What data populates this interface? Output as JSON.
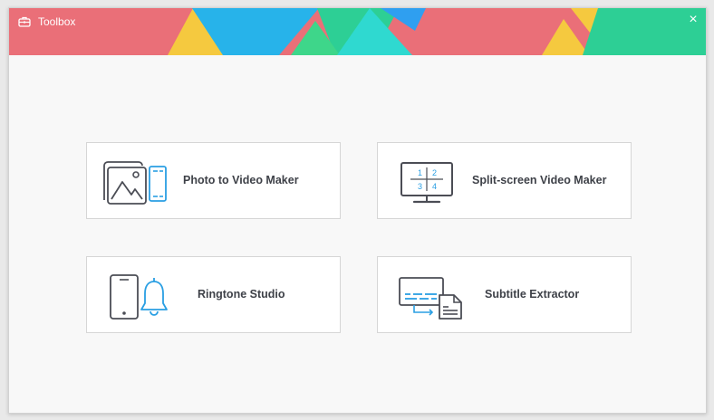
{
  "window": {
    "title": "Toolbox",
    "title_icon": "toolbox-icon",
    "close_icon": "close-icon",
    "close_glyph": "×"
  },
  "banner_colors": [
    "#ea6f78",
    "#f5c93f",
    "#27b3ea",
    "#3ed68a",
    "#2fd9d0",
    "#2f9ff0",
    "#2dcf95"
  ],
  "tools": [
    {
      "id": "photo-to-video-maker",
      "label": "Photo to Video Maker",
      "icon": "photo-film-icon"
    },
    {
      "id": "split-screen-video-maker",
      "label": "Split-screen Video Maker",
      "icon": "split-screen-monitor-icon",
      "icon_numbers": [
        "1",
        "2",
        "3",
        "4"
      ]
    },
    {
      "id": "ringtone-studio",
      "label": "Ringtone Studio",
      "icon": "phone-bell-icon"
    },
    {
      "id": "subtitle-extractor",
      "label": "Subtitle Extractor",
      "icon": "subtitle-document-icon"
    }
  ],
  "colors": {
    "icon_gray": "#4b4d55",
    "icon_accent": "#2a9fe3",
    "label_text": "#3e4148",
    "card_border": "#d6d6d6"
  }
}
